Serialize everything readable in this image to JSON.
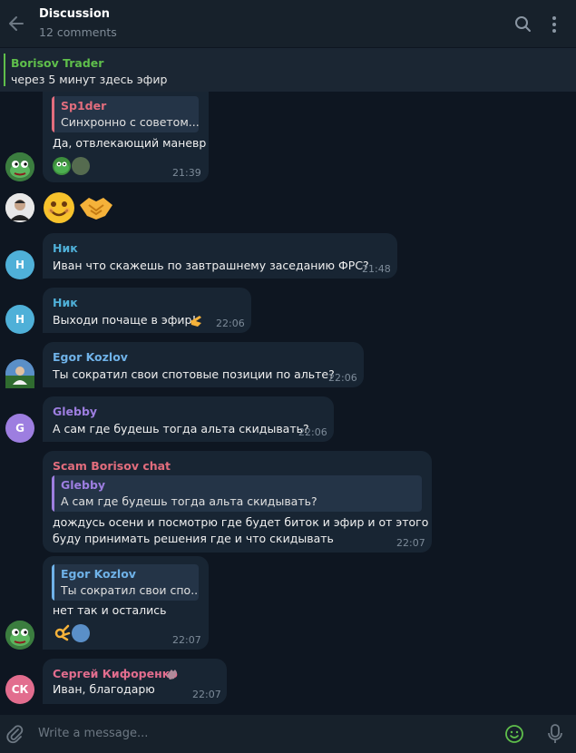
{
  "header": {
    "title": "Discussion",
    "subtitle": "12 comments"
  },
  "pinned": {
    "title": "Borisov Trader",
    "text": "через 5 минут здесь эфир"
  },
  "messages": [
    {
      "reply_name": "Sp1der",
      "reply_text": "Синхронно с советом...",
      "text": "Да, отвлекающий маневр",
      "time": "21:39"
    },
    {
      "sender": "Ник",
      "avatar": "Н",
      "text": "Иван что скажешь по завтрашнему заседанию ФРС?",
      "time": "21:48"
    },
    {
      "sender": "Ник",
      "avatar": "Н",
      "text": "Выходи почаще в эфир!",
      "time": "22:06"
    },
    {
      "sender": "Egor Kozlov",
      "text": "Ты сократил свои спотовые позиции по альте?",
      "time": "22:06"
    },
    {
      "sender": "Glebby",
      "avatar": "G",
      "text": "А сам где будешь тогда альта скидывать?",
      "time": "22:06"
    },
    {
      "sender": "Scam Borisov chat",
      "reply_name": "Glebby",
      "reply_text": "А сам где будешь тогда альта скидывать?",
      "text_line1": "дождусь осени и посмотрю где будет биток и эфир и от этого",
      "text_line2": "буду принимать решения где и что скидывать",
      "time": "22:07"
    },
    {
      "reply_name": "Egor Kozlov",
      "reply_text": "Ты сократил свои спо...",
      "text": "нет так и остались",
      "time": "22:07"
    },
    {
      "sender": "Сергей Кифоренко",
      "avatar": "СК",
      "text": "Иван, благодарю",
      "time": "22:07"
    }
  ],
  "composer": {
    "placeholder": "Write a message..."
  },
  "colors": {
    "background": "#0e1621",
    "bubble": "#182533",
    "pinned_accent": "#5fbf4b",
    "nik": "#4fb0d8",
    "egor": "#6fb2e8",
    "glebby": "#9d7ee0",
    "scam": "#e26d7d",
    "sergey": "#e26d8e"
  }
}
